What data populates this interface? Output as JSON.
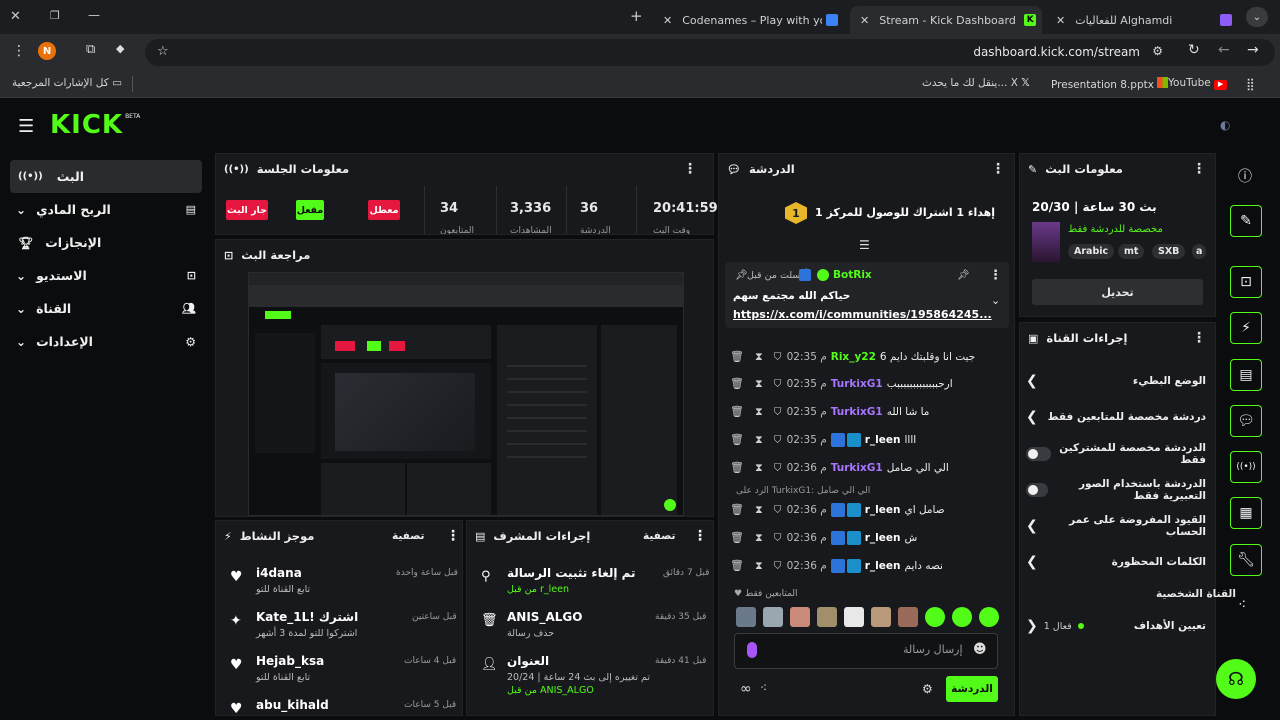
{
  "browser": {
    "tabs": [
      {
        "label": "للفعاليات Alghamdi"
      },
      {
        "label": "Stream - Kick Dashboard"
      },
      {
        "label": "Codenames – Play with your Fri"
      }
    ],
    "url": "dashboard.kick.com/stream",
    "profile_initial": "N",
    "bookmarks": [
      {
        "label": "YouTube"
      },
      {
        "label": "Presentation 8.pptx"
      },
      {
        "label": "ينقل لك ما يحدث... X"
      },
      {
        "label": "كل الإشارات المرجعية"
      }
    ]
  },
  "logo": {
    "text": "KICK",
    "badge": "BETA"
  },
  "sidebar": {
    "items": [
      {
        "label": "البث"
      },
      {
        "label": "الربح المادي"
      },
      {
        "label": "الإنجازات"
      },
      {
        "label": "الاستديو"
      },
      {
        "label": "القناة"
      },
      {
        "label": "الإعدادات"
      }
    ]
  },
  "session": {
    "title": "معلومات الجلسة",
    "live_btn": "جار البث",
    "enabled_btn": "مفعل",
    "disabled_btn": "معطل",
    "stats": [
      "34",
      "3,336",
      "36",
      "20:41:59"
    ],
    "stat_labels": [
      "المتابعون",
      "المشاهدات",
      "الدردشة",
      "وقت البث"
    ]
  },
  "preview": {
    "title": "مراجعة البث"
  },
  "activity": {
    "title": "موجز النشاط",
    "filter": "تصفية",
    "items": [
      {
        "name": "i4dana",
        "sub": "تابع القناة للتو",
        "time": "قبل ساعة واحدة"
      },
      {
        "name": "Kate_1L! اشترك",
        "sub": "اشتركوا للتو لمدة 3 أشهر",
        "time": "قبل ساعتين"
      },
      {
        "name": "Hejab_ksa",
        "sub": "تابع القناة للتو",
        "time": "قبل 4 ساعات"
      },
      {
        "name": "abu_kihald",
        "sub": "",
        "time": "قبل 5 ساعات"
      }
    ]
  },
  "mod": {
    "title": "إجراءات المشرف",
    "filter": "تصفية",
    "items": [
      {
        "title": "تم إلغاء تثبيت الرسالة",
        "by": "من قبل r_leen",
        "time": "قبل 7 دقائق"
      },
      {
        "title": "ANIS_ALGO",
        "by": "حذف رسالة",
        "time": "قبل 35 دقيقة"
      },
      {
        "title": "العنوان",
        "by": "تم تغييره إلى بث 24 ساعة | 20/24",
        "by2": "من قبل ANIS_ALGO",
        "time": "قبل 41 دقيقة"
      }
    ]
  },
  "chat": {
    "title": "الدردشة",
    "goal": "إهداء 1 اشتراك للوصول للمركز 1",
    "goal_rank": "1",
    "pinned": {
      "by": "أرسلت من قبل",
      "user": "BotRix",
      "message": "حياكم الله مجتمع سهم",
      "link": "https://x.com/i/communities/195864245..."
    },
    "messages": [
      {
        "time": "02:35 م",
        "user": "Rix_y22",
        "text": "جيت انا وقلبتك دايم 6"
      },
      {
        "time": "02:35 م",
        "user": "TurkixG1",
        "text": "ارحبببببببببببببب"
      },
      {
        "time": "02:35 م",
        "user": "TurkixG1",
        "text": "ما شا الله"
      },
      {
        "time": "02:35 م",
        "user": "r_leen",
        "text": "اااا"
      },
      {
        "time": "02:36 م",
        "user": "TurkixG1",
        "text": "الي الي صامل"
      },
      {
        "time": "02:36 م",
        "user": "r_leen",
        "text": "صامل اي"
      },
      {
        "time": "02:36 م",
        "user": "r_leen",
        "text": "ش"
      },
      {
        "time": "02:36 م",
        "user": "r_leen",
        "text": "نصه دايم"
      }
    ],
    "reply_to": "الرد على TurkixG1: الي الي صامل",
    "followers_only": "المتابعين فقط",
    "input_placeholder": "إرسال رسالة",
    "send_label": "الدردشة"
  },
  "stream_info": {
    "title": "معلومات البث",
    "stream_title": "بث 30 ساعة | 20/30",
    "subtitle": "مخصصة للدردشة فقط",
    "tags": [
      "Arabic",
      "mt",
      "SXB",
      "a"
    ],
    "edit_label": "تحديل"
  },
  "channel_actions": {
    "title": "إجراءات القناة",
    "rows": [
      {
        "label": "الوضع البطيء"
      },
      {
        "label": "دردشة مخصصة للمتابعين فقط"
      },
      {
        "label": "الدردشة مخصصة للمشتركين فقط"
      },
      {
        "label": "الدردشة باستخدام الصور التعبيرية فقط"
      },
      {
        "label": "القيود المفروضة على عمر الحساب"
      },
      {
        "label": "الكلمات المحظورة"
      }
    ],
    "featured_title": "القناة الشخصية",
    "goals_label": "تعيين الأهداف",
    "goals_value": "فعال 1"
  },
  "colors": {
    "accent": "#53fc18",
    "danger": "#e5173f",
    "username": "#a875ff"
  }
}
